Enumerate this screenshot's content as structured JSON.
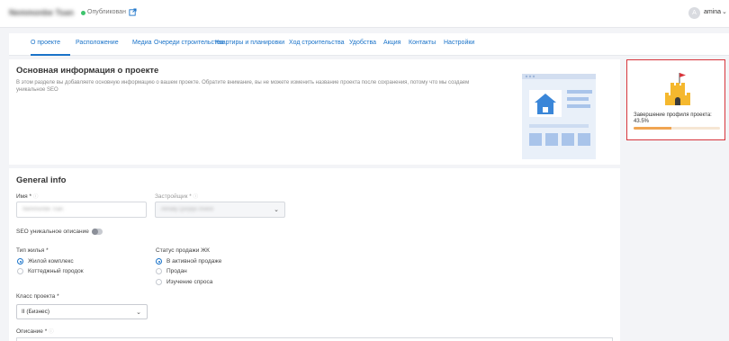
{
  "topbar": {
    "project_name": "Nemmonbe Tsan",
    "status": "Опубликован",
    "user_initial": "A",
    "user_name": "amina",
    "user_caret": "⌄"
  },
  "tabs": [
    {
      "label": "О проекте",
      "active": true
    },
    {
      "label": "Расположение"
    },
    {
      "label": "Медиа"
    },
    {
      "label": "Очереди строительства"
    },
    {
      "label": "Квартиры и планировки"
    },
    {
      "label": "Ход строительства"
    },
    {
      "label": "Удобства"
    },
    {
      "label": "Акция"
    },
    {
      "label": "Контакты"
    },
    {
      "label": "Настройки"
    }
  ],
  "info": {
    "title": "Основная информация о проекте",
    "description": "В этом разделе вы добавляете основную информацию о вашем проекте. Обратите внимание, вы не можете изменить название проекта после сохранения, потому что мы создаем уникальное SEO"
  },
  "progress": {
    "label": "Завершение профиля проекта: 43.5%",
    "value_percent": 43.5,
    "accent_color": "#f0a552",
    "highlight_color": "#d7343b"
  },
  "general": {
    "title": "General info",
    "name_label": "Имя *",
    "name_value": "Nemmonbe Tsan",
    "developer_label": "Застройщик *",
    "developer_value": "Almaty Qurylys Invest",
    "seo_label": "SEO уникальное описание",
    "housing_type_label": "Тип жилья *",
    "housing_types": [
      {
        "label": "Жилой комплекс",
        "checked": true
      },
      {
        "label": "Коттеджный городок",
        "checked": false
      }
    ],
    "sale_status_label": "Статус продажи ЖК",
    "sale_statuses": [
      {
        "label": "В активной продаже",
        "checked": true
      },
      {
        "label": "Продан",
        "checked": false
      },
      {
        "label": "Изучение спроса",
        "checked": false
      }
    ],
    "class_label": "Класс проекта *",
    "class_value": "II (Бизнес)",
    "description_label": "Описание *"
  }
}
